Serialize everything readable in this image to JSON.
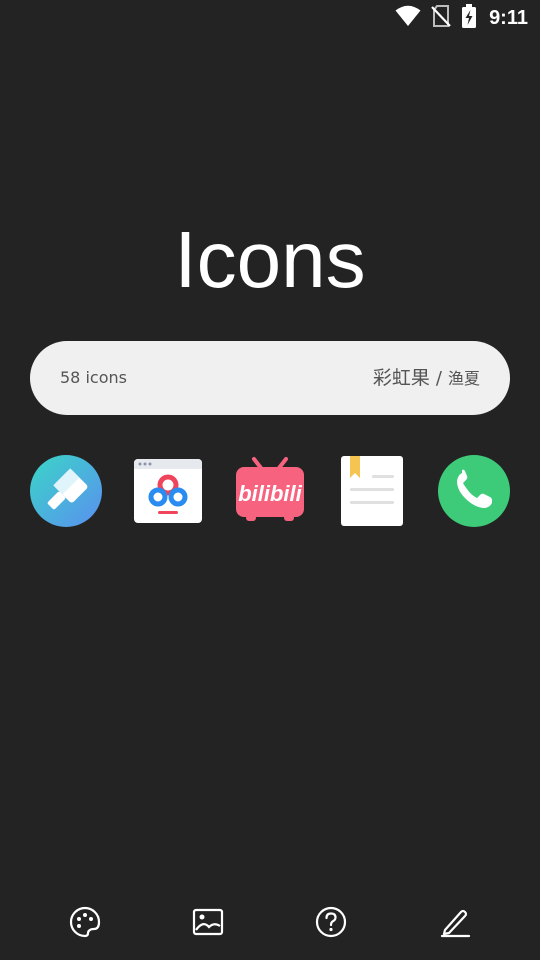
{
  "status_bar": {
    "time": "9:11",
    "icons": [
      "wifi-icon",
      "no-sim-icon",
      "battery-charging-icon"
    ]
  },
  "title": "Icons",
  "info": {
    "count": "58 icons",
    "author_main": "彩虹果",
    "separator": "/",
    "author_second": "渔夏"
  },
  "icons_row": [
    {
      "name": "cleaner-app-icon",
      "colors": [
        "#3ad6c7",
        "#5a8ff0"
      ]
    },
    {
      "name": "baidu-netdisk-app-icon",
      "colors": [
        "#ffffff",
        "#2a8cf0",
        "#f0445a"
      ]
    },
    {
      "name": "bilibili-app-icon",
      "colors": [
        "#f7637f",
        "#ffffff"
      ]
    },
    {
      "name": "notes-app-icon",
      "colors": [
        "#ffffff",
        "#f5c451"
      ]
    },
    {
      "name": "phone-app-icon",
      "colors": [
        "#3ecb79",
        "#ffffff"
      ]
    }
  ],
  "bottom_nav": [
    "palette-icon",
    "image-icon",
    "help-icon",
    "edit-icon"
  ],
  "colors": {
    "background": "#232323",
    "pill": "#f0f0f0",
    "pill_text": "#555555"
  }
}
